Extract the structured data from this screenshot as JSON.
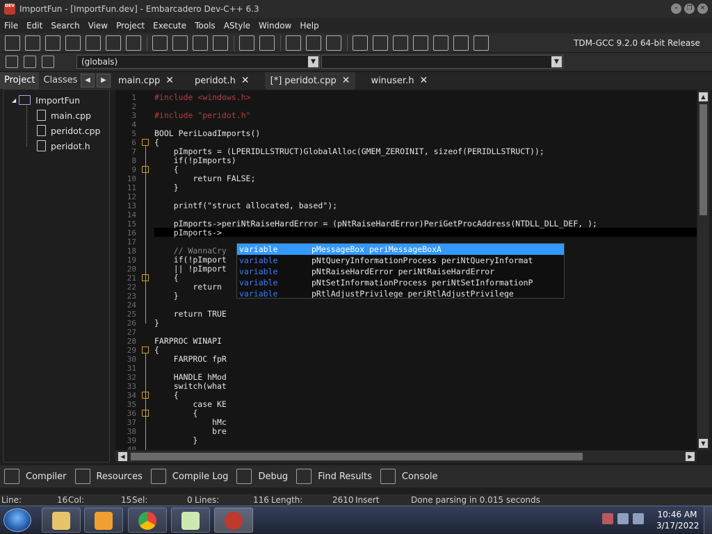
{
  "window": {
    "title": "ImportFun - [ImportFun.dev] - Embarcadero Dev-C++ 6.3",
    "logo_text": "DEV C++"
  },
  "menu": [
    "File",
    "Edit",
    "Search",
    "View",
    "Project",
    "Execute",
    "Tools",
    "AStyle",
    "Window",
    "Help"
  ],
  "toolbar": {
    "compiler": "TDM-GCC 9.2.0 64-bit Release",
    "scope": "(globals)"
  },
  "left_panel": {
    "tabs": [
      "Project",
      "Classes"
    ],
    "tree": {
      "root": "ImportFun",
      "files": [
        "main.cpp",
        "peridot.cpp",
        "peridot.h"
      ]
    }
  },
  "editor_tabs": [
    {
      "label": "main.cpp",
      "active": false
    },
    {
      "label": "peridot.h",
      "active": false
    },
    {
      "label": "[*] peridot.cpp",
      "active": true
    },
    {
      "label": "winuser.h",
      "active": false
    }
  ],
  "code": {
    "line_numbers": [
      "1",
      "2",
      "3",
      "4",
      "5",
      "6",
      "7",
      "8",
      "9",
      "10",
      "11",
      "12",
      "13",
      "14",
      "15",
      "16",
      "17",
      "18",
      "19",
      "20",
      "21",
      "22",
      "23",
      "24",
      "25",
      "26",
      "27",
      "28",
      "29",
      "30",
      "31",
      "32",
      "33",
      "34",
      "35",
      "36",
      "37",
      "38",
      "39",
      "40"
    ],
    "lines": [
      "#include <windows.h>",
      "",
      "#include \"peridot.h\"",
      "",
      "BOOL PeriLoadImports()",
      "{",
      "    pImports = (LPERIDLLSTRUCT)GlobalAlloc(GMEM_ZEROINIT, sizeof(PERIDLLSTRUCT));",
      "    if(!pImports)",
      "    {",
      "        return FALSE;",
      "    }",
      "",
      "    printf(\"struct allocated, based\");",
      "",
      "    pImports->periNtRaiseHardError = (pNtRaiseHardError)PeriGetProcAddress(NTDLL_DLL_DEF, );",
      "    pImports->",
      "",
      "    // WannaCry",
      "    if(!pImport",
      "    || !pImport",
      "    {",
      "        return",
      "    }",
      "",
      "    return TRUE",
      "}",
      "",
      "FARPROC WINAPI",
      "{",
      "    FARPROC fpR",
      "",
      "    HANDLE hMod",
      "    switch(what",
      "    {",
      "        case KE",
      "        {",
      "            hMc",
      "            bre",
      "        }",
      ""
    ]
  },
  "autocomplete": [
    {
      "kind": "variable",
      "text": "pMessageBox periMessageBoxA",
      "selected": true
    },
    {
      "kind": "variable",
      "text": "pNtQueryInformationProcess periNtQueryInformat",
      "selected": false
    },
    {
      "kind": "variable",
      "text": "pNtRaiseHardError periNtRaiseHardError",
      "selected": false
    },
    {
      "kind": "variable",
      "text": "pNtSetInformationProcess periNtSetInformationP",
      "selected": false
    },
    {
      "kind": "variable",
      "text": "pRtlAdjustPrivilege periRtlAdjustPrivilege",
      "selected": false
    }
  ],
  "bottom_tabs": [
    "Compiler",
    "Resources",
    "Compile Log",
    "Debug",
    "Find Results",
    "Console"
  ],
  "status": {
    "line_label": "Line:",
    "line_value": "16",
    "col_label": "Col:",
    "col_value": "15",
    "sel_label": "Sel:",
    "sel_value": "0",
    "lines_label": "Lines:",
    "lines_value": "116",
    "length_label": "Length:",
    "length_value": "2610",
    "mode": "Insert",
    "message": "Done parsing in 0.015 seconds"
  },
  "taskbar": {
    "time": "10:46 AM",
    "date": "3/17/2022",
    "pinned": [
      "file-explorer-icon",
      "media-player-icon",
      "chrome-icon",
      "notepad-icon",
      "devcpp-icon"
    ]
  }
}
